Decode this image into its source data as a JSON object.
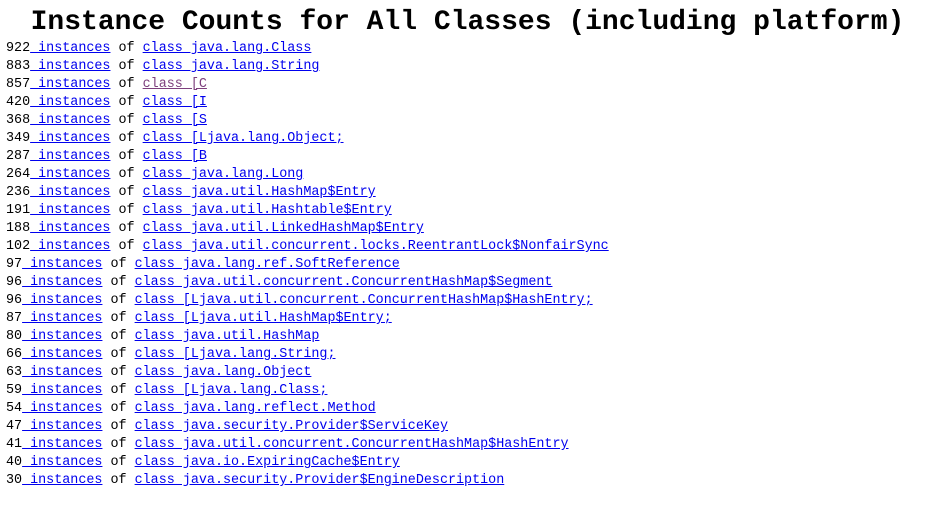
{
  "page": {
    "title": "Instance Counts for All Classes (including platform)",
    "link_color": "#0000ee",
    "visited_link_color": "#7d3f7d",
    "text_color": "#000000",
    "background_color": "#ffffff"
  },
  "labels": {
    "instances_link_text": " instances",
    "of_separator": " of "
  },
  "rows": [
    {
      "count": "922",
      "instances_label": " instances",
      "of": " of ",
      "class_label": "class java.lang.Class",
      "visited": false
    },
    {
      "count": "883",
      "instances_label": " instances",
      "of": " of ",
      "class_label": "class java.lang.String",
      "visited": false
    },
    {
      "count": "857",
      "instances_label": " instances",
      "of": " of ",
      "class_label": "class [C",
      "visited": true
    },
    {
      "count": "420",
      "instances_label": " instances",
      "of": " of ",
      "class_label": "class [I",
      "visited": false
    },
    {
      "count": "368",
      "instances_label": " instances",
      "of": " of ",
      "class_label": "class [S",
      "visited": false
    },
    {
      "count": "349",
      "instances_label": " instances",
      "of": " of ",
      "class_label": "class [Ljava.lang.Object;",
      "visited": false
    },
    {
      "count": "287",
      "instances_label": " instances",
      "of": " of ",
      "class_label": "class [B",
      "visited": false
    },
    {
      "count": "264",
      "instances_label": " instances",
      "of": " of ",
      "class_label": "class java.lang.Long",
      "visited": false
    },
    {
      "count": "236",
      "instances_label": " instances",
      "of": " of ",
      "class_label": "class java.util.HashMap$Entry",
      "visited": false
    },
    {
      "count": "191",
      "instances_label": " instances",
      "of": " of ",
      "class_label": "class java.util.Hashtable$Entry",
      "visited": false
    },
    {
      "count": "188",
      "instances_label": " instances",
      "of": " of ",
      "class_label": "class java.util.LinkedHashMap$Entry",
      "visited": false
    },
    {
      "count": "102",
      "instances_label": " instances",
      "of": " of ",
      "class_label": "class java.util.concurrent.locks.ReentrantLock$NonfairSync",
      "visited": false
    },
    {
      "count": "97",
      "instances_label": " instances",
      "of": " of ",
      "class_label": "class java.lang.ref.SoftReference",
      "visited": false
    },
    {
      "count": "96",
      "instances_label": " instances",
      "of": " of ",
      "class_label": "class java.util.concurrent.ConcurrentHashMap$Segment",
      "visited": false
    },
    {
      "count": "96",
      "instances_label": " instances",
      "of": " of ",
      "class_label": "class [Ljava.util.concurrent.ConcurrentHashMap$HashEntry;",
      "visited": false
    },
    {
      "count": "87",
      "instances_label": " instances",
      "of": " of ",
      "class_label": "class [Ljava.util.HashMap$Entry;",
      "visited": false
    },
    {
      "count": "80",
      "instances_label": " instances",
      "of": " of ",
      "class_label": "class java.util.HashMap",
      "visited": false
    },
    {
      "count": "66",
      "instances_label": " instances",
      "of": " of ",
      "class_label": "class [Ljava.lang.String;",
      "visited": false
    },
    {
      "count": "63",
      "instances_label": " instances",
      "of": " of ",
      "class_label": "class java.lang.Object",
      "visited": false
    },
    {
      "count": "59",
      "instances_label": " instances",
      "of": " of ",
      "class_label": "class [Ljava.lang.Class;",
      "visited": false
    },
    {
      "count": "54",
      "instances_label": " instances",
      "of": " of ",
      "class_label": "class java.lang.reflect.Method",
      "visited": false
    },
    {
      "count": "47",
      "instances_label": " instances",
      "of": " of ",
      "class_label": "class java.security.Provider$ServiceKey",
      "visited": false
    },
    {
      "count": "41",
      "instances_label": " instances",
      "of": " of ",
      "class_label": "class java.util.concurrent.ConcurrentHashMap$HashEntry",
      "visited": false
    },
    {
      "count": "40",
      "instances_label": " instances",
      "of": " of ",
      "class_label": "class java.io.ExpiringCache$Entry",
      "visited": false
    },
    {
      "count": "30",
      "instances_label": " instances",
      "of": " of ",
      "class_label": "class java.security.Provider$EngineDescription",
      "visited": false
    }
  ]
}
